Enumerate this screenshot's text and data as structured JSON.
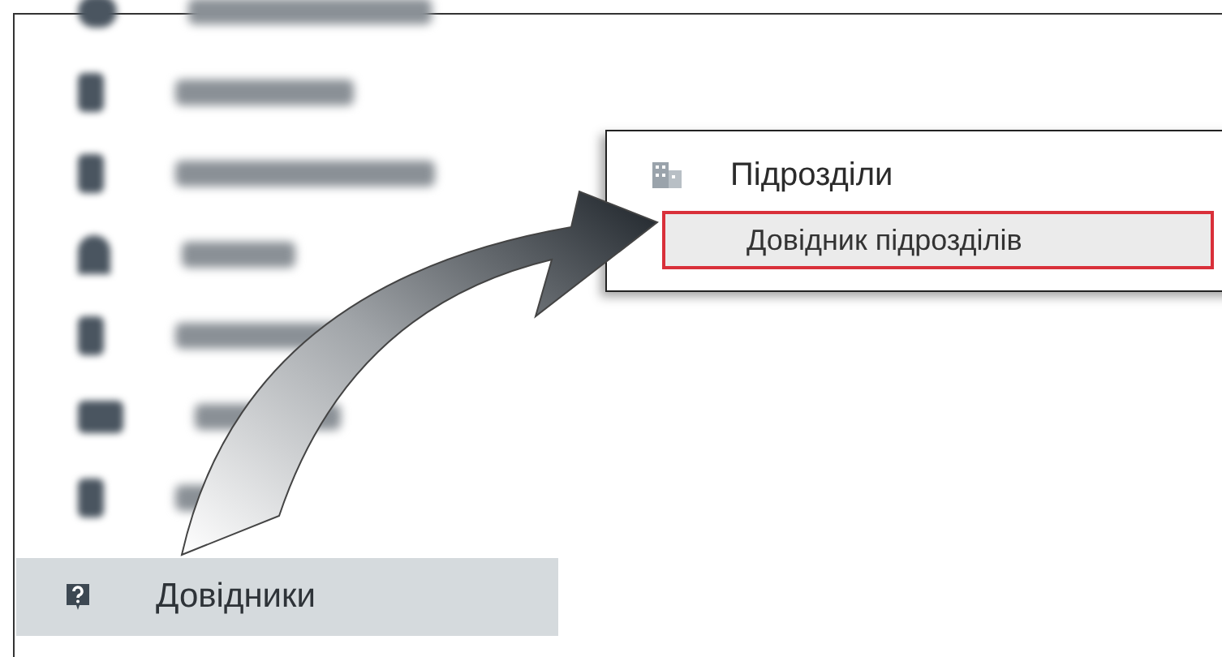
{
  "sidebar": {
    "items": [
      {
        "kind": "blurred"
      },
      {
        "kind": "blurred"
      },
      {
        "kind": "blurred"
      },
      {
        "kind": "blurred"
      },
      {
        "kind": "blurred"
      },
      {
        "kind": "blurred"
      },
      {
        "kind": "blurred"
      },
      {
        "kind": "label",
        "label": "Довідники",
        "selected": true
      }
    ]
  },
  "menu": {
    "title": "Підрозділи",
    "items": [
      {
        "label": "Довідник підрозділів",
        "highlighted": true
      }
    ]
  }
}
